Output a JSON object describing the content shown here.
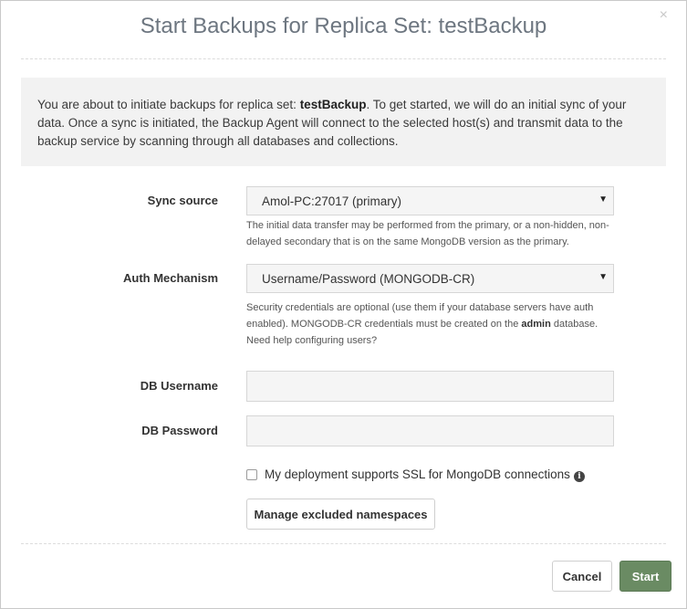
{
  "dialog": {
    "title": "Start Backups for Replica Set: testBackup",
    "close_glyph": "×"
  },
  "intro": {
    "text_before": "You are about to initiate backups for replica set: ",
    "replica_set": "testBackup",
    "text_after": ". To get started, we will do an initial sync of your data. Once a sync is initiated, the Backup Agent will connect to the selected host(s) and transmit data to the backup service by scanning through all databases and collections."
  },
  "sync_source": {
    "label": "Sync source",
    "value": "Amol-PC:27017 (primary)",
    "help": "The initial data transfer may be performed from the primary, or a non-hidden, non-delayed secondary that is on the same MongoDB version as the primary."
  },
  "auth": {
    "label": "Auth Mechanism",
    "value": "Username/Password (MONGODB-CR)",
    "help_before": "Security credentials are optional (use them if your database servers have auth enabled). MONGODB-CR credentials must be created on the ",
    "help_bold": "admin",
    "help_after": " database.",
    "help_link": "Need help configuring users?"
  },
  "db_username": {
    "label": "DB Username",
    "value": ""
  },
  "db_password": {
    "label": "DB Password",
    "value": ""
  },
  "ssl": {
    "label": "My deployment supports SSL for MongoDB connections",
    "checked": false,
    "info_glyph": "i"
  },
  "buttons": {
    "manage": "Manage excluded namespaces",
    "cancel": "Cancel",
    "start": "Start"
  },
  "icons": {
    "dropdown": "▼"
  },
  "colors": {
    "start_button": "#6a8b63",
    "title": "#6d7680"
  }
}
